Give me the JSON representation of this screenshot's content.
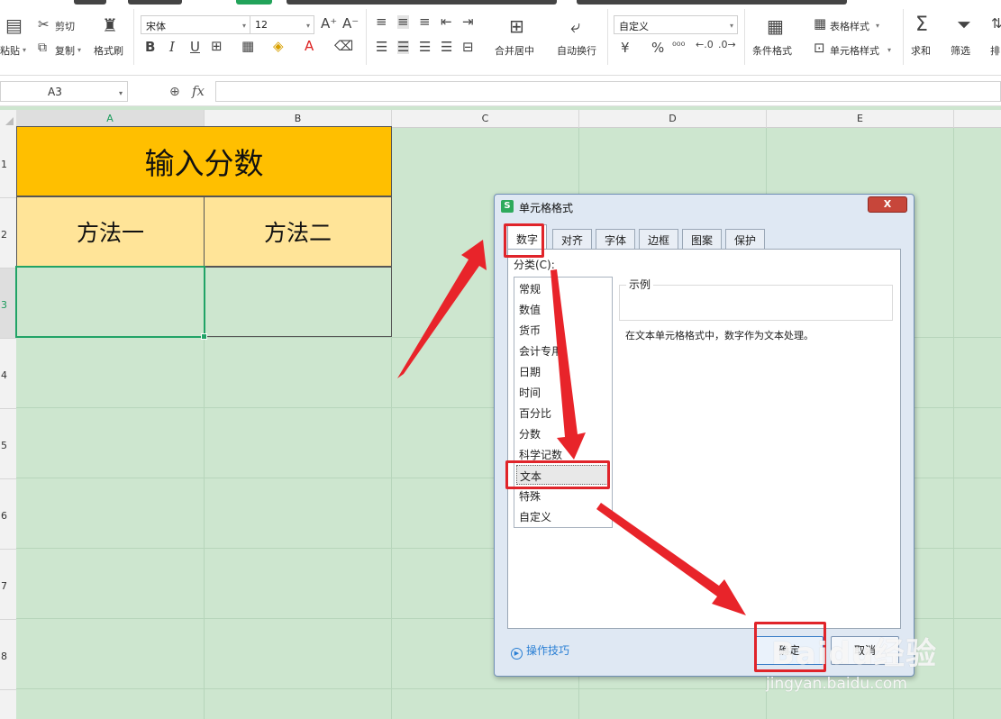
{
  "ribbon": {
    "paste": "粘贴",
    "cut": "剪切",
    "copy": "复制",
    "format_painter": "格式刷",
    "font_name": "宋体",
    "font_size": "12",
    "merge_center": "合并居中",
    "wrap_text": "自动换行",
    "number_format": "自定义",
    "conditional_format": "条件格式",
    "table_style": "表格样式",
    "cell_style": "单元格样式",
    "sum": "求和",
    "filter": "筛选",
    "sort": "排"
  },
  "formula_bar": {
    "name_box": "A3",
    "fx_label": "fx",
    "content": ""
  },
  "sheet": {
    "columns": [
      "A",
      "B",
      "C",
      "D",
      "E"
    ],
    "rows": [
      "1",
      "2",
      "3",
      "4",
      "5",
      "6",
      "7",
      "8"
    ],
    "title": "输入分数",
    "header_a": "方法一",
    "header_b": "方法二",
    "selected_cell": "A3",
    "colors": {
      "grid_bg": "#cde6cf",
      "title_bg": "#ffbf00",
      "subheader_bg": "#ffe498",
      "selection": "#21a366"
    }
  },
  "dialog": {
    "icon": "S",
    "title": "单元格格式",
    "close": "X",
    "tabs": [
      "数字",
      "对齐",
      "字体",
      "边框",
      "图案",
      "保护"
    ],
    "active_tab": "数字",
    "category_label": "分类(C):",
    "categories": [
      "常规",
      "数值",
      "货币",
      "会计专用",
      "日期",
      "时间",
      "百分比",
      "分数",
      "科学记数",
      "文本",
      "特殊",
      "自定义"
    ],
    "selected_category": "文本",
    "sample_label": "示例",
    "description": "在文本单元格格式中，数字作为文本处理。",
    "tips": "操作技巧",
    "ok": "确定",
    "cancel": "取消"
  },
  "annotation": {
    "color": "#e0242a"
  },
  "watermark": {
    "logo": "Baidu经验",
    "url": "jingyan.baidu.com"
  }
}
